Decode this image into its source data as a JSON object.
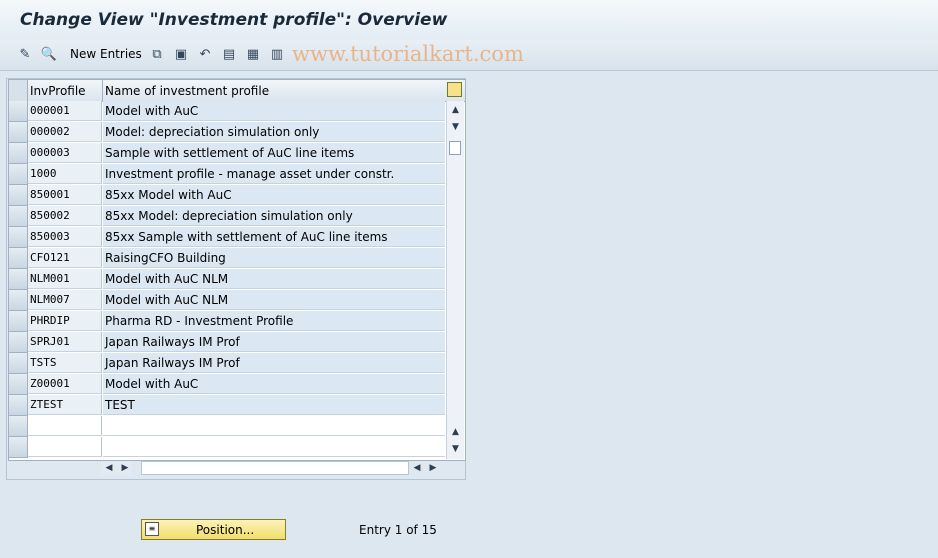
{
  "window": {
    "title": "Change View \"Investment profile\": Overview"
  },
  "toolbar": {
    "new_entries_label": "New Entries",
    "watermark": "www.tutorialkart.com"
  },
  "table": {
    "columns": [
      "InvProfile",
      "Name of investment profile"
    ],
    "rows": [
      {
        "key": "000001",
        "name": "Model with AuC"
      },
      {
        "key": "000002",
        "name": "Model: depreciation simulation only"
      },
      {
        "key": "000003",
        "name": "Sample with settlement of AuC line items"
      },
      {
        "key": "1000",
        "name": "Investment profile - manage asset under constr."
      },
      {
        "key": "850001",
        "name": "85xx Model with AuC"
      },
      {
        "key": "850002",
        "name": "85xx Model: depreciation simulation only"
      },
      {
        "key": "850003",
        "name": "85xx Sample with settlement of AuC line items"
      },
      {
        "key": "CFO121",
        "name": "RaisingCFO Building"
      },
      {
        "key": "NLM001",
        "name": "Model with AuC NLM"
      },
      {
        "key": "NLM007",
        "name": "Model with AuC NLM"
      },
      {
        "key": "PHRDIP",
        "name": "Pharma RD - Investment Profile"
      },
      {
        "key": "SPRJ01",
        "name": "Japan Railways IM Prof"
      },
      {
        "key": "TSTS",
        "name": "Japan Railways IM Prof"
      },
      {
        "key": "Z00001",
        "name": "Model with AuC"
      },
      {
        "key": "ZTEST",
        "name": "TEST"
      }
    ]
  },
  "footer": {
    "position_label": "Position...",
    "entry_text": "Entry 1 of 15"
  }
}
